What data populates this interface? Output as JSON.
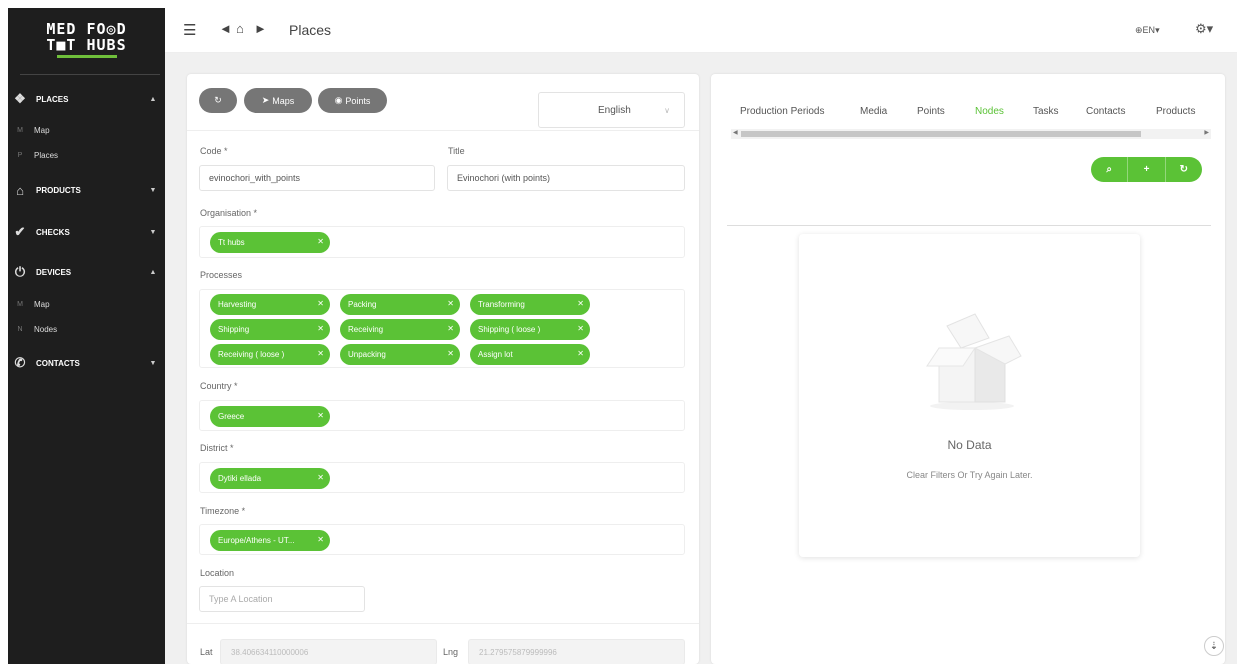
{
  "app": {
    "logo_line1": "MED FO◎D",
    "logo_line2": "T■T HUBS"
  },
  "sidebar": {
    "places": {
      "label": "PLACES",
      "subs": [
        {
          "letter": "M",
          "label": "Map"
        },
        {
          "letter": "P",
          "label": "Places"
        }
      ]
    },
    "products": {
      "label": "PRODUCTS"
    },
    "checks": {
      "label": "CHECKS"
    },
    "devices": {
      "label": "DEVICES",
      "subs": [
        {
          "letter": "M",
          "label": "Map"
        },
        {
          "letter": "N",
          "label": "Nodes"
        }
      ]
    },
    "contacts": {
      "label": "CONTACTS"
    }
  },
  "topbar": {
    "title": "Places",
    "lang": "EN"
  },
  "form": {
    "buttons": {
      "maps": "Maps",
      "points": "Points"
    },
    "language": "English",
    "code_label": "Code *",
    "code_value": "evinochori_with_points",
    "title_label": "Title",
    "title_value": "Evinochori (with points)",
    "organisation_label": "Organisation *",
    "organisation_tag": "Tt hubs",
    "processes_label": "Processes",
    "processes": [
      "Harvesting",
      "Packing",
      "Transforming",
      "Shipping",
      "Receiving",
      "Shipping ( loose )",
      "Receiving ( loose )",
      "Unpacking",
      "Assign lot"
    ],
    "country_label": "Country *",
    "country_tag": "Greece",
    "district_label": "District *",
    "district_tag": "Dytiki ellada",
    "timezone_label": "Timezone *",
    "timezone_tag": "Europe/Athens - UT...",
    "location_label": "Location",
    "location_placeholder": "Type A Location",
    "lat_label": "Lat",
    "lat_value": "38.406634110000006",
    "lng_label": "Lng",
    "lng_value": "21.279575879999996"
  },
  "right": {
    "tabs": [
      "Production Periods",
      "Media",
      "Points",
      "Nodes",
      "Tasks",
      "Contacts",
      "Products"
    ],
    "active_tab": "Nodes",
    "nodata_title": "No Data",
    "nodata_sub": "Clear Filters Or Try Again Later."
  },
  "colors": {
    "accent": "#5bc236",
    "sidebar": "#1e1e1e"
  }
}
